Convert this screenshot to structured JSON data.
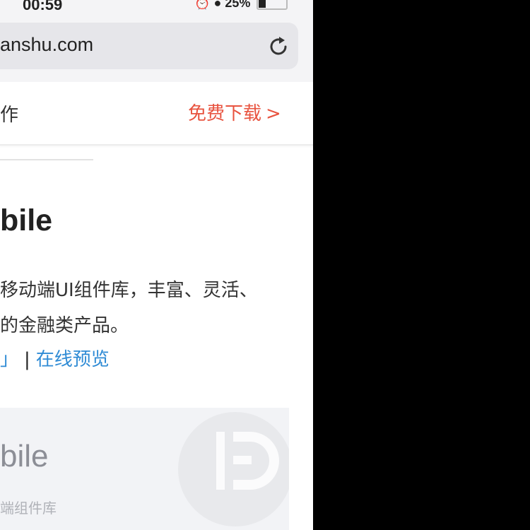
{
  "status_bar": {
    "time": "00:59",
    "battery_percent": "25%"
  },
  "browser": {
    "url": "anshu.com"
  },
  "site_header": {
    "left_text": "作",
    "download_label": "免费下载",
    "download_arrow": ">"
  },
  "article": {
    "title": "bile",
    "description_line1": "移动端UI组件库，丰富、灵活、",
    "description_line2": "的金融类产品。",
    "link_left": "」",
    "link_separator": "|",
    "link_preview": "在线预览"
  },
  "banner": {
    "title": "bile",
    "subtitle": "端组件库"
  },
  "colors": {
    "accent_red": "#e8533f",
    "link_blue": "#2f8bd5"
  }
}
